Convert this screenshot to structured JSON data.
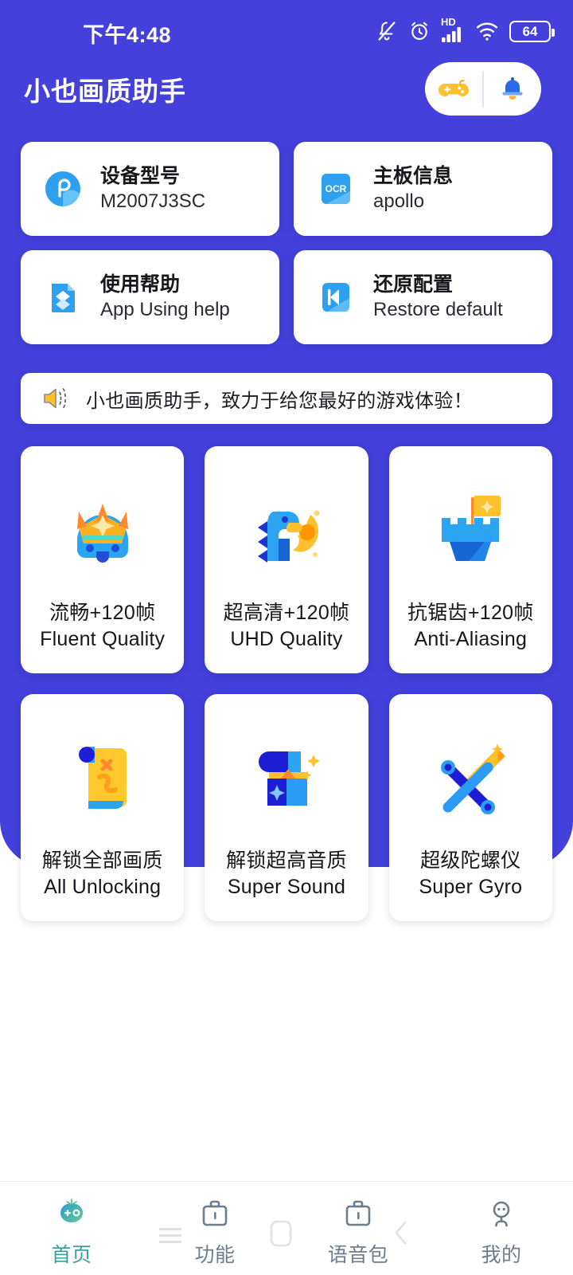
{
  "statusbar": {
    "time": "下午4:48",
    "battery_level": "64",
    "hd_label": "HD",
    "icons": [
      "mute-bell-icon",
      "alarm-clock-icon",
      "hd-icon",
      "signal-bars-icon",
      "wifi-icon",
      "battery-icon"
    ]
  },
  "header": {
    "title": "小也画质助手",
    "buttons": [
      {
        "name": "gamepad-button",
        "icon": "gamepad-icon"
      },
      {
        "name": "notification-button",
        "icon": "bell-icon"
      }
    ]
  },
  "info_cards": [
    {
      "title": "设备型号",
      "sub": "M2007J3SC",
      "icon": "device-circle-icon"
    },
    {
      "title": "主板信息",
      "sub": "apollo",
      "icon": "ocr-icon"
    },
    {
      "title": "使用帮助",
      "sub": "App Using help",
      "icon": "layers-doc-icon"
    },
    {
      "title": "还原配置",
      "sub": "Restore default",
      "icon": "restore-icon"
    }
  ],
  "notice": {
    "icon": "speaker-icon",
    "text": "小也画质助手，致力于给您最好的游戏体验！"
  },
  "features": [
    {
      "cn": "流畅+120帧",
      "en": "Fluent Quality",
      "icon": "crown-monster-icon"
    },
    {
      "cn": "超高清+120帧",
      "en": "UHD Quality",
      "icon": "fire-dino-icon"
    },
    {
      "cn": "抗锯齿+120帧",
      "en": "Anti-Aliasing",
      "icon": "castle-flag-icon"
    },
    {
      "cn": "解锁全部画质",
      "en": "All Unlocking",
      "icon": "scroll-icon"
    },
    {
      "cn": "解锁超高音质",
      "en": "Super Sound",
      "icon": "sparkle-cube-icon"
    },
    {
      "cn": "超级陀螺仪",
      "en": "Super Gyro",
      "icon": "sword-icon"
    }
  ],
  "bottom_nav": [
    {
      "label": "首页",
      "icon": "home-gamepad-icon",
      "active": true
    },
    {
      "label": "功能",
      "icon": "briefcase-icon",
      "active": false
    },
    {
      "label": "语音包",
      "icon": "briefcase-icon",
      "active": false
    },
    {
      "label": "我的",
      "icon": "profile-icon",
      "active": false
    }
  ],
  "colors": {
    "background_purple": "#4340DB",
    "card_white": "#FFFFFF",
    "accent_yellow": "#FFC02E",
    "accent_blue": "#2B9CF5",
    "nav_active_teal": "#3C9F9B",
    "nav_inactive": "#6D7D8C"
  }
}
